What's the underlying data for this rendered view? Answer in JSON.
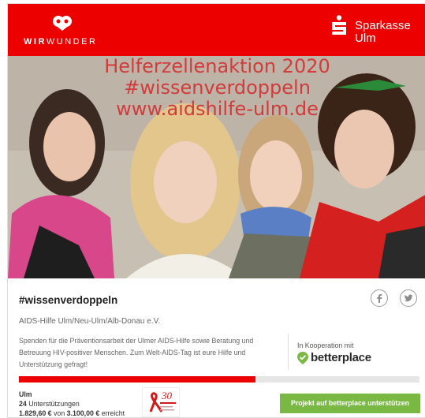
{
  "header": {
    "left_brand": {
      "part1": "WIR",
      "part2": "WUNDER"
    },
    "right_brand": {
      "line1": "Sparkasse",
      "line2": "Ulm"
    },
    "background": "#ed0000"
  },
  "image": {
    "overlay_lines": [
      "Helferzellenaktion 2020",
      "#wissenverdoppeln",
      "www.aidshilfe-ulm.de"
    ],
    "overlay_color": "#d23b3b"
  },
  "project": {
    "title": "#wissenverdoppeln",
    "organization": "AIDS-Hilfe Ulm/Neu-Ulm/Alb-Donau e.V.",
    "description": "Spenden für die Präventionsarbeit der Ulmer AIDS-Hilfe sowie Beratung und Betreuung HIV-positiver Menschen. Zum Welt-AIDS-Tag ist eure Hilfe und Unterstützung gefragt!",
    "cooperation_label": "In Kooperation mit",
    "partner": "betterplace",
    "social": [
      "facebook-icon",
      "twitter-icon"
    ]
  },
  "funding": {
    "progress_fraction": 0.59,
    "progress_color": "#ed0000",
    "city": "Ulm",
    "supporters_count": "24",
    "supporters_label": " Unterstützungen",
    "raised": "1.829,60 €",
    "of_label": " von ",
    "goal": "3.100,00 €",
    "reached_label": " erreicht",
    "cta_label": "Projekt auf betterplace unterstützen",
    "cta_color": "#79b843"
  }
}
